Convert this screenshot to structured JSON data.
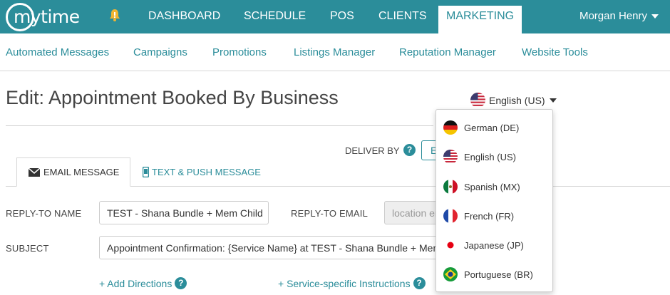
{
  "header": {
    "logo_text": "mytime",
    "nav": [
      {
        "label": "DASHBOARD"
      },
      {
        "label": "SCHEDULE"
      },
      {
        "label": "POS"
      },
      {
        "label": "CLIENTS"
      },
      {
        "label": "MARKETING",
        "active": true
      }
    ],
    "user_name": "Morgan Henry",
    "icons": {
      "logo": "mytime-logo",
      "notifications": "bell-icon",
      "user_menu": "chevron-down-icon"
    },
    "colors": {
      "brand": "#2b8d9a",
      "bell": "#f0b431"
    }
  },
  "subnav": {
    "items": [
      {
        "label": "Automated Messages"
      },
      {
        "label": "Campaigns"
      },
      {
        "label": "Promotions"
      },
      {
        "label": "Listings Manager"
      },
      {
        "label": "Reputation Manager"
      },
      {
        "label": "Website Tools"
      }
    ]
  },
  "page": {
    "title": "Edit: Appointment Booked By Business",
    "language": {
      "selected": "English (US)",
      "options": [
        {
          "label": "German (DE)",
          "flag": "flag-de-icon"
        },
        {
          "label": "English (US)",
          "flag": "flag-us-icon"
        },
        {
          "label": "Spanish (MX)",
          "flag": "flag-mx-icon"
        },
        {
          "label": "French (FR)",
          "flag": "flag-fr-icon"
        },
        {
          "label": "Japanese (JP)",
          "flag": "flag-jp-icon"
        },
        {
          "label": "Portuguese (BR)",
          "flag": "flag-br-icon"
        }
      ]
    },
    "deliver": {
      "label": "DELIVER BY",
      "value": "E"
    }
  },
  "tabs": [
    {
      "label": "EMAIL MESSAGE",
      "icon": "envelope-icon",
      "active": true
    },
    {
      "label": "TEXT & PUSH MESSAGE",
      "icon": "phone-icon",
      "active": false
    }
  ],
  "form": {
    "reply_to_name": {
      "label": "REPLY-TO NAME",
      "value": "TEST - Shana Bundle + Mem Child"
    },
    "reply_to_email": {
      "label": "REPLY-TO EMAIL",
      "placeholder": "location email"
    },
    "subject": {
      "label": "SUBJECT",
      "value": "Appointment Confirmation: {Service Name} at TEST - Shana Bundle + Mem Child"
    },
    "links": [
      {
        "label": "+ Add Directions"
      },
      {
        "label": "+ Service-specific Instructions"
      }
    ],
    "help_glyph": "?"
  }
}
